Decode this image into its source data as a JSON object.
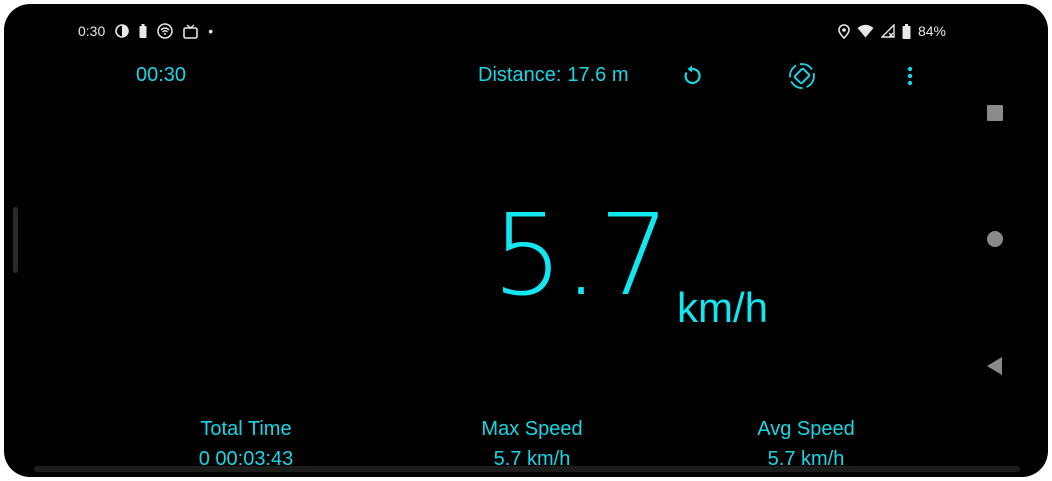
{
  "status_bar": {
    "time": "0:30",
    "battery_percent": "84%",
    "dot": "•",
    "icons_left": [
      "circle-half-icon",
      "battery-small-icon",
      "wifi-off-icon",
      "tv-icon"
    ],
    "icons_right": [
      "location-icon",
      "wifi-icon",
      "signal-icon",
      "battery-icon"
    ]
  },
  "toolbar": {
    "clock": "00:30",
    "distance_label": "Distance:",
    "distance_value": "17.6 m",
    "actions": [
      "reset-icon",
      "rotate-screen-icon",
      "more-vert-icon"
    ]
  },
  "speed": {
    "value": "5.7",
    "unit": "km/h"
  },
  "stats": {
    "total_time": {
      "label": "Total Time",
      "value": "0 00:03:43"
    },
    "max_speed": {
      "label": "Max Speed",
      "value": "5.7 km/h"
    },
    "avg_speed": {
      "label": "Avg Speed",
      "value": "5.7 km/h"
    }
  },
  "nav_bar": [
    "recents-square-icon",
    "home-circle-icon",
    "back-triangle-icon"
  ],
  "colors": {
    "accent": "#19d6e6",
    "background": "#000000",
    "status_text": "#e8e8e8"
  }
}
